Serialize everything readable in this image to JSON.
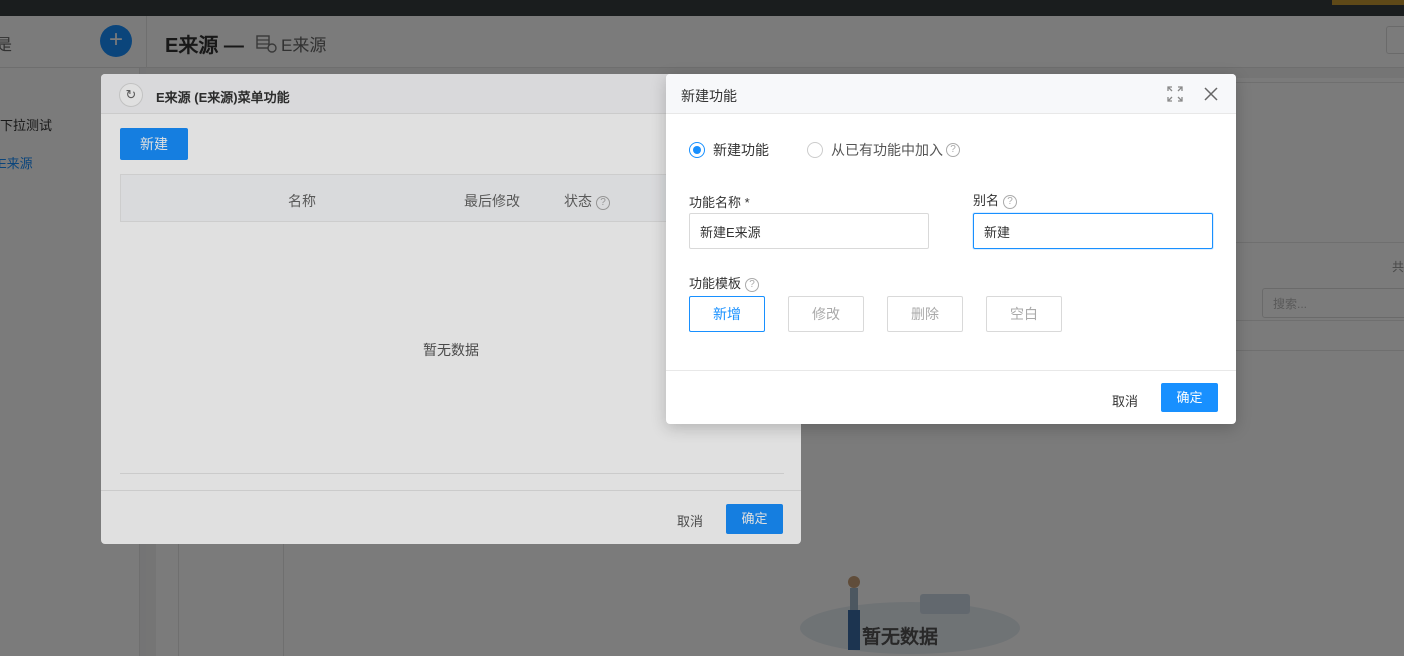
{
  "header": {
    "left_char": "是",
    "add_icon": "plus-icon",
    "title": "E来源",
    "dash": "—",
    "subtitle": "E来源"
  },
  "sidebar": {
    "items": [
      {
        "label": "下拉测试",
        "active": false
      },
      {
        "label": "E来源",
        "active": true
      }
    ]
  },
  "background": {
    "right_label": "共",
    "search_placeholder": "搜索...",
    "empty_text": "暂无数据"
  },
  "menu_dialog": {
    "title": "E来源 (E来源)菜单功能",
    "refresh_icon": "refresh-icon",
    "new_button": "新建",
    "columns": {
      "name": "名称",
      "modified": "最后修改",
      "status": "状态"
    },
    "help_glyph": "?",
    "empty_text": "暂无数据",
    "cancel": "取消",
    "ok": "确定"
  },
  "new_dialog": {
    "title": "新建功能",
    "radio_new": "新建功能",
    "radio_existing": "从已有功能中加入",
    "selected_option": "新建功能",
    "name_label": "功能名称 *",
    "name_value": "新建E来源",
    "alias_label": "别名",
    "alias_value": "新建",
    "template_label": "功能模板",
    "help_glyph": "?",
    "templates": [
      {
        "label": "新增",
        "selected": true
      },
      {
        "label": "修改",
        "selected": false
      },
      {
        "label": "删除",
        "selected": false
      },
      {
        "label": "空白",
        "selected": false
      }
    ],
    "cancel": "取消",
    "ok": "确定"
  },
  "colors": {
    "primary": "#1890ff",
    "mask": "rgba(0,0,0,0.45)",
    "top_bar": "#373d41"
  }
}
